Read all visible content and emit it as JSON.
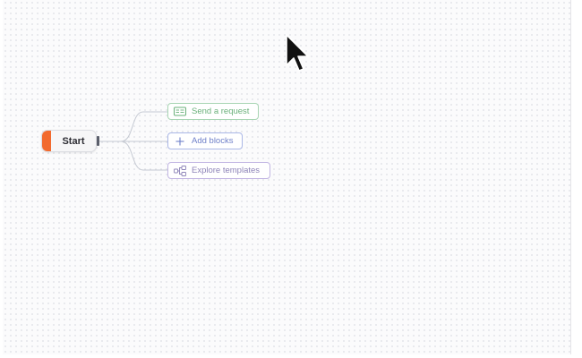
{
  "canvas": {
    "start_node": {
      "label": "Start",
      "accent_color": "#f26a2e"
    },
    "options": [
      {
        "label": "Send a request",
        "icon": "send-request-icon",
        "color": "#6ab07a"
      },
      {
        "label": "Add blocks",
        "icon": "plus-icon",
        "color": "#6f80c9"
      },
      {
        "label": "Explore templates",
        "icon": "templates-icon",
        "color": "#8e84b8"
      }
    ]
  },
  "cursor": {
    "icon": "mouse-pointer-icon"
  }
}
